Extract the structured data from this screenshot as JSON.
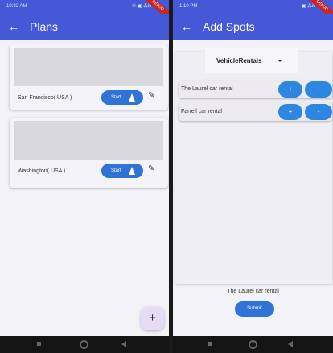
{
  "left_screen": {
    "status": {
      "time": "10:22 AM",
      "icons_right": "✆ ▣ ⁂ill",
      "ribbon": "DEBUG"
    },
    "appbar": {
      "back_icon": "←",
      "title": "Plans"
    },
    "plans": [
      {
        "place": "San Francisco( USA )",
        "start_label": "Start"
      },
      {
        "place": "Washington( USA )",
        "start_label": "Start"
      }
    ],
    "fab": {
      "label": "+"
    }
  },
  "right_screen": {
    "status": {
      "time": "1:10 PM",
      "icons_right": "▣ ⁂ill",
      "ribbon": "DEBUG"
    },
    "appbar": {
      "back_icon": "←",
      "title": "Add Spots"
    },
    "dropdown": {
      "value": "VehicleRentals"
    },
    "rentals": [
      {
        "name": "The Laurel car rental",
        "plus": "+",
        "minus": "-"
      },
      {
        "name": "Farrell car rental",
        "plus": "+",
        "minus": "-"
      }
    ],
    "selected_text": "The Laurel car rental",
    "submit_label": "Submit"
  },
  "colors": {
    "appbar": "#4558d8",
    "primary_button": "#2f73d6",
    "fab": "#e6dcf5"
  }
}
